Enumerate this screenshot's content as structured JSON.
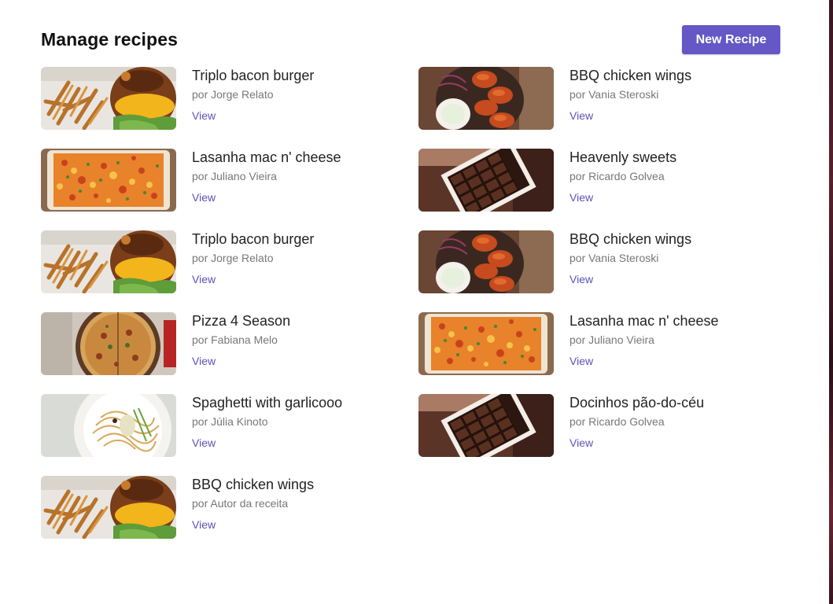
{
  "header": {
    "title": "Manage recipes",
    "new_recipe_label": "New Recipe"
  },
  "recipes_left": [
    {
      "title": "Triplo bacon burger",
      "author": "por Jorge Relato",
      "view": "View",
      "image": "burger"
    },
    {
      "title": "Lasanha mac n' cheese",
      "author": "por Juliano Vieira",
      "view": "View",
      "image": "lasagna"
    },
    {
      "title": "Triplo bacon burger",
      "author": "por Jorge Relato",
      "view": "View",
      "image": "burger"
    },
    {
      "title": "Pizza 4 Season",
      "author": "por Fabiana Melo",
      "view": "View",
      "image": "pizza"
    },
    {
      "title": "Spaghetti with garlicooo",
      "author": "por Júlia Kinoto",
      "view": "View",
      "image": "spaghetti"
    },
    {
      "title": "BBQ chicken wings",
      "author": "por Autor da receita",
      "view": "View",
      "image": "burger"
    }
  ],
  "recipes_right": [
    {
      "title": "BBQ chicken wings",
      "author": "por Vania Steroski",
      "view": "View",
      "image": "wings"
    },
    {
      "title": "Heavenly sweets",
      "author": "por Ricardo Golvea",
      "view": "View",
      "image": "chocolates"
    },
    {
      "title": "BBQ chicken wings",
      "author": "por Vania Steroski",
      "view": "View",
      "image": "wings"
    },
    {
      "title": "Lasanha mac n' cheese",
      "author": "por Juliano Vieira",
      "view": "View",
      "image": "lasagna"
    },
    {
      "title": "Docinhos pão-do-céu",
      "author": "por Ricardo Golvea",
      "view": "View",
      "image": "chocolates"
    }
  ],
  "colors": {
    "accent": "#6557c6",
    "link": "#5b52b8"
  }
}
